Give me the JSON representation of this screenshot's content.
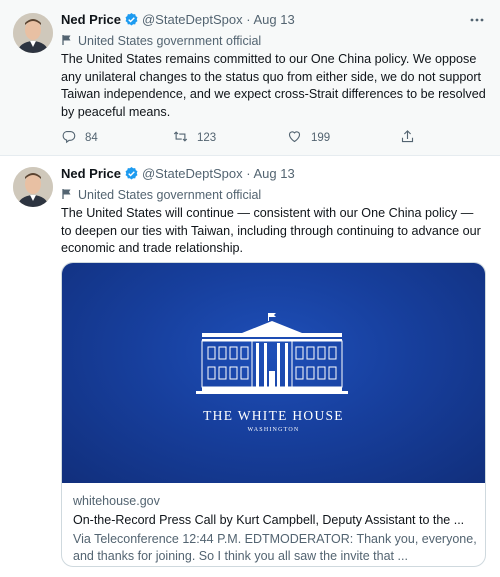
{
  "tweets": [
    {
      "author_name": "Ned Price",
      "handle": "@StateDeptSpox",
      "separator": "·",
      "date": "Aug 13",
      "official_label": "United States government official",
      "text": "The United States remains committed to our One China policy. We oppose any unilateral changes to the status quo from either side, we do not support Taiwan independence, and we expect cross-Strait differences to be resolved by peaceful means.",
      "replies": "84",
      "retweets": "123",
      "likes": "199"
    },
    {
      "author_name": "Ned Price",
      "handle": "@StateDeptSpox",
      "separator": "·",
      "date": "Aug 13",
      "official_label": "United States government official",
      "text": "The United States will continue — consistent with our One China policy — to deepen our ties with Taiwan, including through continuing to advance our economic and trade relationship.",
      "card": {
        "image_title": "THE WHITE HOUSE",
        "image_subtitle": "WASHINGTON",
        "domain": "whitehouse.gov",
        "title": "On-the-Record Press Call by Kurt Campbell, Deputy Assistant to the ...",
        "description": "Via Teleconference 12:44 P.M. EDTMODERATOR:  Thank you, everyone, and thanks for joining.  So I think you all saw the invite that ..."
      }
    }
  ],
  "icons": {
    "verified": "verified-badge-icon",
    "official": "flag-icon",
    "more": "more-options-icon",
    "reply": "reply-icon",
    "retweet": "retweet-icon",
    "like": "heart-icon",
    "share": "share-icon"
  },
  "colors": {
    "verified": "#1d9bf0",
    "secondary_text": "#536471",
    "card_background": "#173f9d"
  }
}
